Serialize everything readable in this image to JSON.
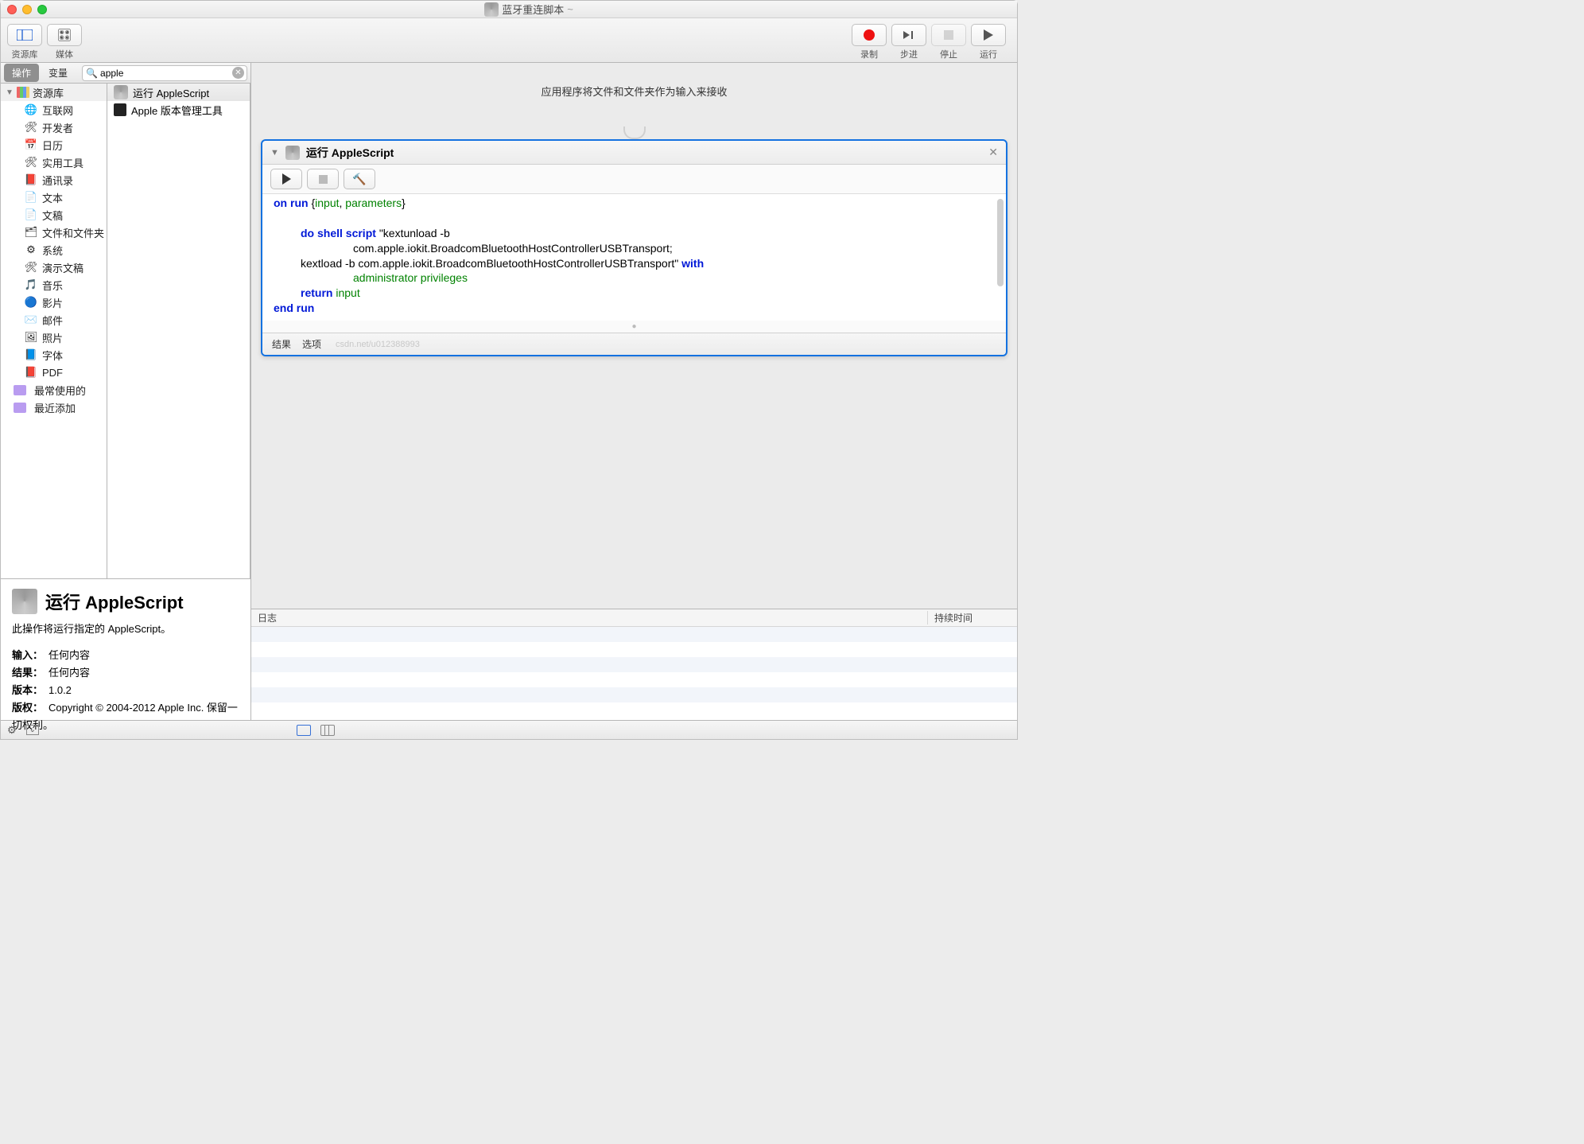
{
  "window": {
    "title": "蓝牙重连脚本",
    "modified": "~"
  },
  "toolbar": {
    "library": "资源库",
    "media": "媒体",
    "record": "录制",
    "step": "步进",
    "stop": "停止",
    "run": "运行"
  },
  "tabs": {
    "actions": "操作",
    "variables": "变量"
  },
  "search": {
    "value": "apple",
    "placeholder": ""
  },
  "library_root": "资源库",
  "library_items": [
    {
      "label": "互联网",
      "icon": "🌐"
    },
    {
      "label": "开发者",
      "icon": "🛠"
    },
    {
      "label": "日历",
      "icon": "📅"
    },
    {
      "label": "实用工具",
      "icon": "🛠"
    },
    {
      "label": "通讯录",
      "icon": "📕"
    },
    {
      "label": "文本",
      "icon": "📄"
    },
    {
      "label": "文稿",
      "icon": "📄"
    },
    {
      "label": "文件和文件夹",
      "icon": "🗂"
    },
    {
      "label": "系统",
      "icon": "⚙"
    },
    {
      "label": "演示文稿",
      "icon": "🛠"
    },
    {
      "label": "音乐",
      "icon": "🎵"
    },
    {
      "label": "影片",
      "icon": "🔵"
    },
    {
      "label": "邮件",
      "icon": "✉️"
    },
    {
      "label": "照片",
      "icon": "🖼"
    },
    {
      "label": "字体",
      "icon": "📘"
    },
    {
      "label": "PDF",
      "icon": "📕"
    }
  ],
  "library_folders": [
    {
      "label": "最常使用的"
    },
    {
      "label": "最近添加"
    }
  ],
  "actions_list": [
    {
      "label": "运行 AppleScript",
      "selected": true,
      "icon": "script"
    },
    {
      "label": "Apple 版本管理工具",
      "selected": false,
      "icon": "black"
    }
  ],
  "detail": {
    "title": "运行 AppleScript",
    "desc": "此操作将运行指定的 AppleScript。",
    "input_label": "输入：",
    "input_val": "任何内容",
    "result_label": "结果：",
    "result_val": "任何内容",
    "version_label": "版本：",
    "version_val": "1.0.2",
    "copyright_label": "版权：",
    "copyright_val": "Copyright © 2004-2012 Apple Inc.  保留一切权利。"
  },
  "workflow": {
    "drop_hint": "应用程序将文件和文件夹作为输入来接收",
    "card_title": "运行 AppleScript",
    "footer": {
      "result": "结果",
      "options": "选项"
    },
    "watermark": "csdn.net/u012388993",
    "code": {
      "l1a": "on ",
      "l1b": "run ",
      "l1c": "{",
      "l1d": "input",
      "l1e": ", ",
      "l1f": "parameters",
      "l1g": "}",
      "l2a": "do shell script ",
      "l2b": "\"kextunload -b",
      "l3": "com.apple.iokit.BroadcomBluetoothHostControllerUSBTransport;",
      "l4a": "kextload -b com.apple.iokit.BroadcomBluetoothHostControllerUSBTransport\" ",
      "l4b": "with",
      "l5": "administrator privileges",
      "l6a": "return ",
      "l6b": "input",
      "l7a": "end ",
      "l7b": "run"
    }
  },
  "log": {
    "col1": "日志",
    "col2": "持续时间"
  }
}
